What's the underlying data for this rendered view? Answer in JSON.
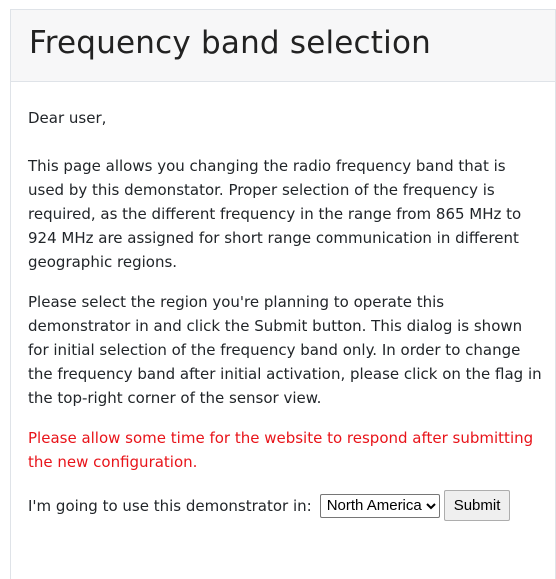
{
  "header": {
    "title": "Frequency band selection"
  },
  "body": {
    "greeting": "Dear user,",
    "paragraph1": "This page allows you changing the radio frequency band that is used by this demonstator. Proper selection of the frequency is required, as the different frequency in the range from 865 MHz to 924 MHz are assigned for short range communication in different geographic regions.",
    "paragraph2": "Please select the region you're planning to operate this demonstrator in and click the Submit button. This dialog is shown for initial selection of the frequency band only. In order to change the frequency band after initial activation, please click on the flag in the top-right corner of the sensor view.",
    "warning": "Please allow some time for the website to respond after submitting the new configuration."
  },
  "form": {
    "label": "I'm going to use this demonstrator in:",
    "region_selected": "North America",
    "submit_label": "Submit"
  },
  "colors": {
    "warning": "#e8141a",
    "header_bg": "#f7f7f8"
  }
}
